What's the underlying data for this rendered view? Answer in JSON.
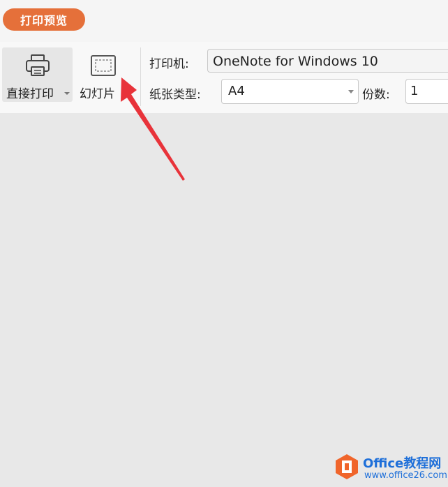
{
  "header": {
    "tab_label": "打印预览"
  },
  "toolbar": {
    "direct_print_label": "直接打印",
    "slides_label": "幻灯片",
    "printer_label": "打印机:",
    "printer_value": "OneNote for Windows 10",
    "paper_label": "纸张类型:",
    "paper_value": "A4",
    "copies_label": "份数:",
    "copies_value": "1"
  },
  "icons": {
    "printer": "printer-icon",
    "slides": "slide-frame-icon",
    "dropdown": "chevron-down-icon"
  },
  "watermark": {
    "title": "Office教程网",
    "url": "www.office26.com"
  },
  "colors": {
    "accent": "#e5703a",
    "annotation_arrow": "#e8333a",
    "watermark_blue": "#1e6fd9",
    "logo_orange": "#f0652b"
  }
}
